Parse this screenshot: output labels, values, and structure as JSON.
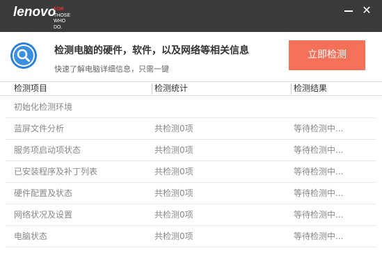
{
  "brand": {
    "word": "lenovo",
    "tag_line1": "FOR",
    "tag_line2": "THOSE",
    "tag_line3": "WHO DO."
  },
  "window": {
    "minimize_label": "—",
    "close_label": "✕"
  },
  "header": {
    "title": "检测电脑的硬件，软件，以及网络等相关信息",
    "subtitle": "快速了解电脑详细信息，只需一键",
    "scan_button": "立即检测",
    "icon": "search-icon"
  },
  "table": {
    "columns": [
      "检测项目",
      "检测统计",
      "检测结果"
    ],
    "rows": [
      {
        "item": "初始化检测环境",
        "stat": "",
        "result": ""
      },
      {
        "item": "蓝屏文件分析",
        "stat": "共检测0项",
        "result": "等待检测中..."
      },
      {
        "item": "服务项启动项状态",
        "stat": "共检测0项",
        "result": "等待检测中..."
      },
      {
        "item": "已安装程序及补丁列表",
        "stat": "共检测0项",
        "result": "等待检测中..."
      },
      {
        "item": "硬件配置及状态",
        "stat": "共检测0项",
        "result": "等待检测中..."
      },
      {
        "item": "网络状况及设置",
        "stat": "共检测0项",
        "result": "等待检测中..."
      },
      {
        "item": "电脑状态",
        "stat": "共检测0项",
        "result": "等待检测中..."
      }
    ]
  },
  "colors": {
    "titlebar": "#3a3a3a",
    "accent": "#f47058",
    "brand_red": "#e4322b",
    "icon_blue": "#2a7fd6"
  }
}
